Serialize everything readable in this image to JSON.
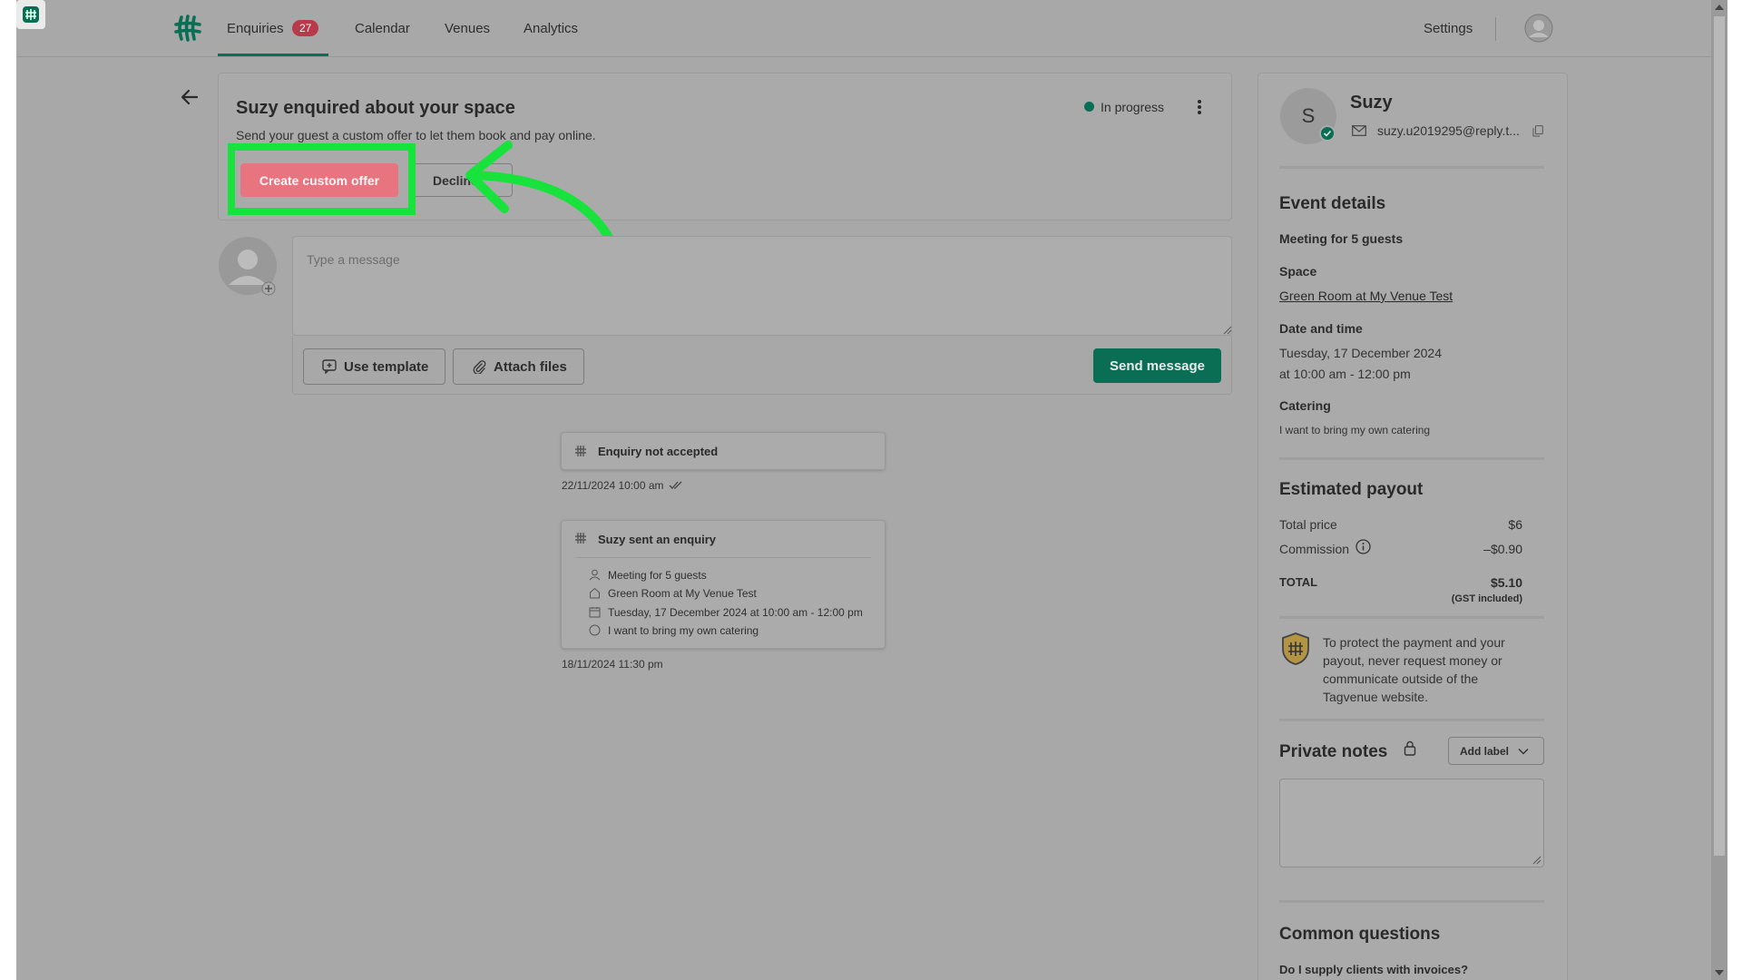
{
  "nav": {
    "enquiries": "Enquiries",
    "enquiries_count": "27",
    "calendar": "Calendar",
    "venues": "Venues",
    "analytics": "Analytics",
    "settings": "Settings"
  },
  "header": {
    "title": "Suzy enquired about your space",
    "subtitle": "Send your guest a custom offer to let them book and pay online.",
    "status": "In progress",
    "create_offer": "Create custom offer",
    "decline": "Decline"
  },
  "composer": {
    "placeholder": "Type a message",
    "use_template": "Use template",
    "attach_files": "Attach files",
    "send": "Send message"
  },
  "timeline": {
    "event1": {
      "title": "Enquiry not accepted",
      "time": "22/11/2024 10:00 am"
    },
    "event2": {
      "title": "Suzy sent an enquiry",
      "rows": [
        "Meeting for 5 guests",
        "Green Room at My Venue Test",
        "Tuesday, 17 December 2024 at 10:00 am - 12:00 pm",
        "I want to bring my own catering"
      ],
      "time": "18/11/2024 11:30 pm"
    }
  },
  "guest": {
    "initial": "S",
    "name": "Suzy",
    "email": "suzy.u2019295@reply.t..."
  },
  "event_details": {
    "heading": "Event details",
    "summary": "Meeting for 5 guests",
    "space_label": "Space",
    "space_value": "Green Room at My Venue Test",
    "datetime_label": "Date and time",
    "date": "Tuesday, 17 December 2024",
    "time": "at 10:00 am - 12:00 pm",
    "catering_label": "Catering",
    "catering_value": "I want to bring my own catering"
  },
  "payout": {
    "heading": "Estimated payout",
    "total_price_label": "Total price",
    "total_price": "$6",
    "commission_label": "Commission",
    "commission": "–$0.90",
    "total_label": "TOTAL",
    "total": "$5.10",
    "gst": "(GST included)",
    "protect": "To protect the payment and your payout, never request money or communicate outside of the Tagvenue website."
  },
  "notes": {
    "heading": "Private notes",
    "add_label": "Add label"
  },
  "faq": {
    "heading": "Common questions",
    "q1": "Do I supply clients with invoices?"
  },
  "colors": {
    "brand_green": "#0a6e55",
    "create_button": "#e7747e",
    "badge": "#b83a4a",
    "highlight": "#18e33d"
  }
}
